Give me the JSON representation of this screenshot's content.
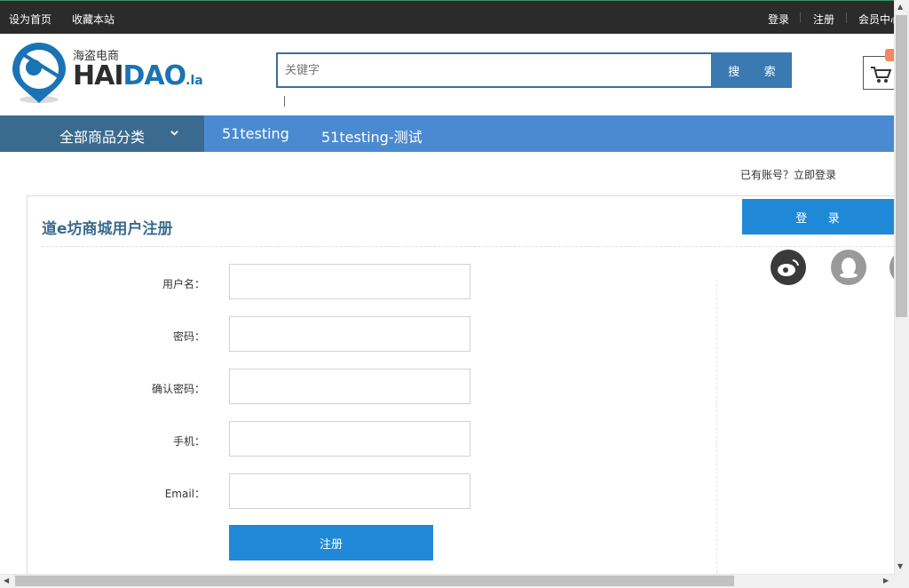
{
  "topbar": {
    "set_home": "设为首页",
    "bookmark": "收藏本站",
    "login": "登录",
    "register": "注册",
    "member_center": "会员中心"
  },
  "logo": {
    "cn": "海盗电商",
    "en_dark": "HAI",
    "en_blue": "DAO",
    "en_suffix": ".la"
  },
  "search": {
    "placeholder": "关键字",
    "button": "搜 索"
  },
  "nav": {
    "all_categories": "全部商品分类",
    "links": [
      "51testing",
      "51testing-测试"
    ]
  },
  "register_form": {
    "title": "道e坊商城用户注册",
    "fields": [
      {
        "label": "用户名：",
        "value": ""
      },
      {
        "label": "密码：",
        "value": ""
      },
      {
        "label": "确认密码：",
        "value": ""
      },
      {
        "label": "手机：",
        "value": ""
      },
      {
        "label": "Email：",
        "value": ""
      }
    ],
    "submit": "注册"
  },
  "login_side": {
    "prompt": "已有账号？立即登录",
    "button": "登 录",
    "social_icons": [
      "weibo-icon",
      "qq-icon",
      "other-social-icon"
    ]
  },
  "colors": {
    "topbar": "#2b2b2b",
    "nav": "#4a8ad0",
    "nav_all": "#3a6b8f",
    "primary_button": "#2089d7",
    "title": "#3a6b8f"
  }
}
